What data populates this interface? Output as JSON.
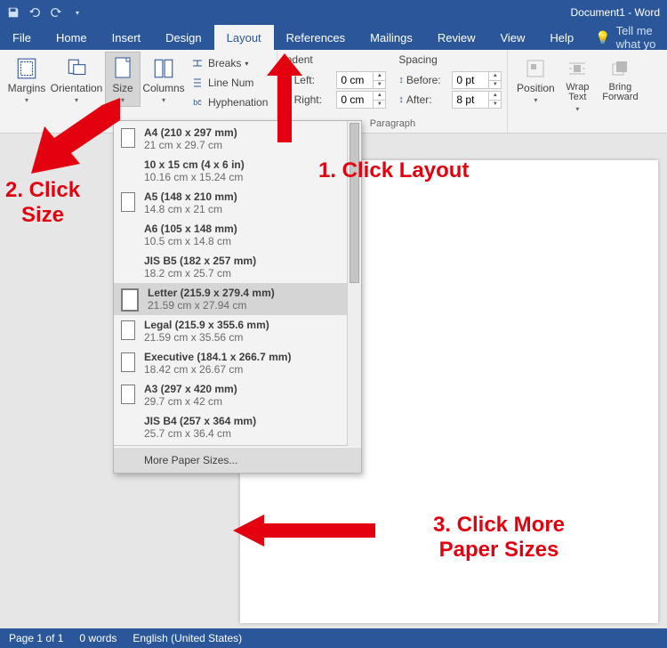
{
  "title": "Document1 - Word",
  "tabs": [
    "File",
    "Home",
    "Insert",
    "Design",
    "Layout",
    "References",
    "Mailings",
    "Review",
    "View",
    "Help"
  ],
  "active_tab": 4,
  "tell_me": "Tell me what yo",
  "page_setup": {
    "margins": "Margins",
    "orientation": "Orientation",
    "size": "Size",
    "columns": "Columns",
    "breaks": "Breaks",
    "line_numbers": "Line Num",
    "hyphenation": "Hyphenation"
  },
  "indent": {
    "label": "Indent",
    "left_label": "Left:",
    "right_label": "Right:",
    "left_value": "0 cm",
    "right_value": "0 cm"
  },
  "spacing": {
    "label": "Spacing",
    "before_label": "Before:",
    "after_label": "After:",
    "before_value": "0 pt",
    "after_value": "8 pt"
  },
  "paragraph_label": "Paragraph",
  "arrange": {
    "position": "Position",
    "wrap": "Wrap Text",
    "bring": "Bring Forward"
  },
  "sizes": [
    {
      "title": "A4 (210 x 297 mm)",
      "sub": "21 cm x 29.7 cm",
      "icon": true,
      "selected": false
    },
    {
      "title": "10 x 15 cm (4 x 6 in)",
      "sub": "10.16 cm x 15.24 cm",
      "icon": false,
      "selected": false
    },
    {
      "title": "A5 (148 x 210 mm)",
      "sub": "14.8 cm x 21 cm",
      "icon": true,
      "selected": false
    },
    {
      "title": "A6 (105 x 148 mm)",
      "sub": "10.5 cm x 14.8 cm",
      "icon": false,
      "selected": false
    },
    {
      "title": "JIS B5 (182 x 257 mm)",
      "sub": "18.2 cm x 25.7 cm",
      "icon": false,
      "selected": false
    },
    {
      "title": "Letter (215.9 x 279.4 mm)",
      "sub": "21.59 cm x 27.94 cm",
      "icon": true,
      "selected": true
    },
    {
      "title": "Legal (215.9 x 355.6 mm)",
      "sub": "21.59 cm x 35.56 cm",
      "icon": true,
      "selected": false
    },
    {
      "title": "Executive (184.1 x 266.7 mm)",
      "sub": "18.42 cm x 26.67 cm",
      "icon": true,
      "selected": false
    },
    {
      "title": "A3 (297 x 420 mm)",
      "sub": "29.7 cm x 42 cm",
      "icon": true,
      "selected": false
    },
    {
      "title": "JIS B4 (257 x 364 mm)",
      "sub": "25.7 cm x 36.4 cm",
      "icon": false,
      "selected": false
    }
  ],
  "more_sizes": "More Paper Sizes...",
  "status": {
    "page": "Page 1 of 1",
    "words": "0 words",
    "lang": "English (United States)"
  },
  "anno": {
    "a1": "1. Click Layout",
    "a2a": "2. Click",
    "a2b": "Size",
    "a3a": "3. Click More",
    "a3b": "Paper Sizes"
  }
}
